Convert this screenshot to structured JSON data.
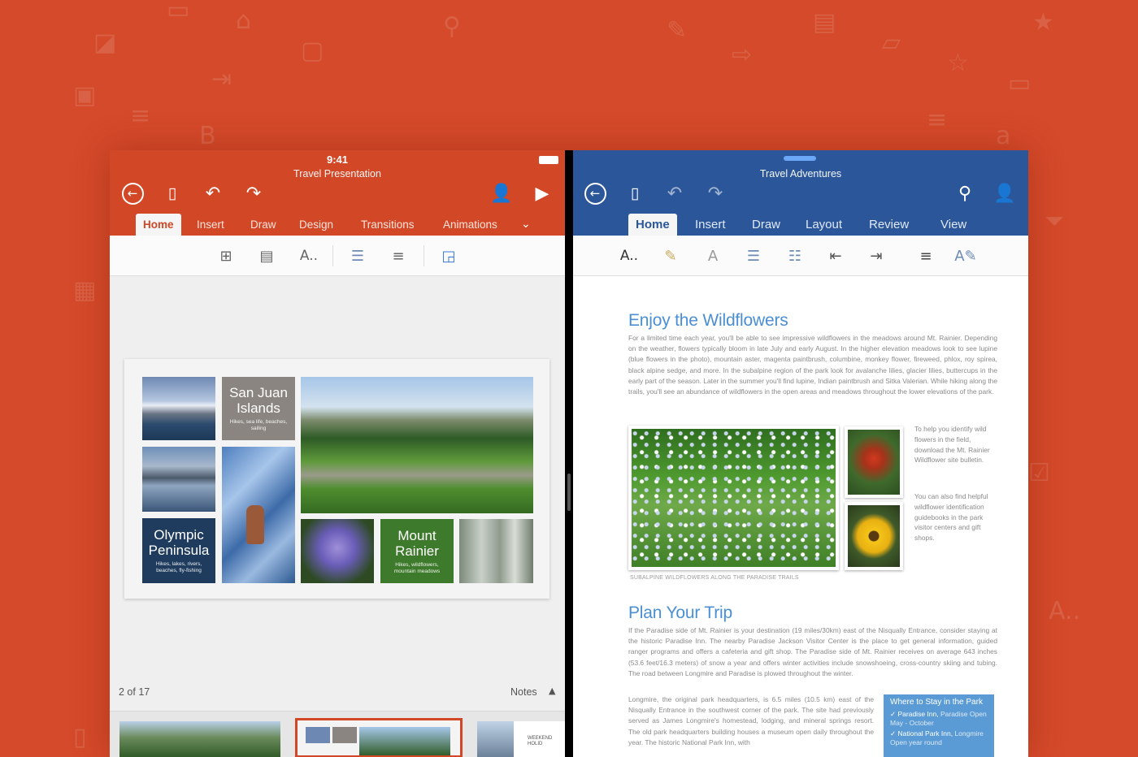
{
  "status_bar": {
    "time": "9:41"
  },
  "powerpoint": {
    "title": "Travel Presentation",
    "tabs": [
      "Home",
      "Insert",
      "Draw",
      "Design",
      "Transitions",
      "Animations"
    ],
    "active_tab": "Home",
    "slide": {
      "tiles": [
        {
          "title": "San Juan Islands",
          "subtitle": "Hikes, sea life, beaches, sailing"
        },
        {
          "title": "Olympic Peninsula",
          "subtitle": "Hikes, lakes, rivers, beaches, fly-fishing"
        },
        {
          "title": "Mount Rainier",
          "subtitle": "Hikes, wildflowers, mountain meadows"
        }
      ]
    },
    "slide_counter": "2 of 17",
    "notes_label": "Notes",
    "thumb_text": "WEEKEND HOLID",
    "colors": {
      "brand": "#d24726"
    }
  },
  "word": {
    "title": "Travel Adventures",
    "tabs": [
      "Home",
      "Insert",
      "Draw",
      "Layout",
      "Review",
      "View"
    ],
    "active_tab": "Home",
    "heading1": "Enjoy the Wildflowers",
    "para1": "For a limited time each year, you'll be able to see impressive wildflowers in the meadows around Mt. Rainier. Depending on the weather, flowers typically bloom in late July and early August. In the higher elevation meadows look to see lupine (blue flowers in the photo), mountain aster, magenta paintbrush, columbine, monkey flower, fireweed, phlox, roy spirea, black alpine sedge, and more. In the subalpine region of the park look for avalanche lilies, glacier lilies, buttercups in the early part of the season. Later in the summer you'll find lupine, Indian paintbrush and Sitka Valerian. While hiking along the trails, you'll see an abundance of wildflowers in the open areas and meadows throughout the lower elevations of the park.",
    "side_para1": "To help you identify wild flowers in the field, download the Mt. Rainier Wildflower site bulletin.",
    "side_para2": "You can also find helpful wildflower identification guidebooks in the park visitor centers and gift shops.",
    "caption": "SUBALPINE WILDFLOWERS ALONG THE PARADISE TRAILS",
    "heading2": "Plan Your Trip",
    "para2": "If the Paradise side of Mt. Rainier is your destination (19 miles/30km) east of the Nisqually Entrance, consider staying at the historic Paradise Inn. The nearby Paradise Jackson Visitor Center is the place to get general information, guided ranger programs and offers a cafeteria and gift shop. The Paradise side of Mt. Rainier receives on average 643 inches (53.6 feet/16.3 meters) of snow a year and offers winter activities include snowshoeing, cross-country skiing and tubing. The road between Longmire and Paradise is plowed throughout the winter.",
    "para3": "Longmire, the original park headquarters, is 6.5 miles (10.5 km) east of the Nisqually Entrance in the southwest corner of the park. The site had previously served as James Longmire's homestead, lodging, and mineral springs resort. The old park headquarters building houses a museum open daily throughout the year. The historic National Park Inn, with",
    "sidebar": {
      "title": "Where to Stay in the Park",
      "items": [
        {
          "name": "Paradise Inn",
          "detail": "Paradise Open May - October"
        },
        {
          "name": "National Park Inn",
          "detail": "Longmire Open year round"
        }
      ]
    },
    "colors": {
      "brand": "#2b579a",
      "heading": "#4a8fd4"
    }
  }
}
